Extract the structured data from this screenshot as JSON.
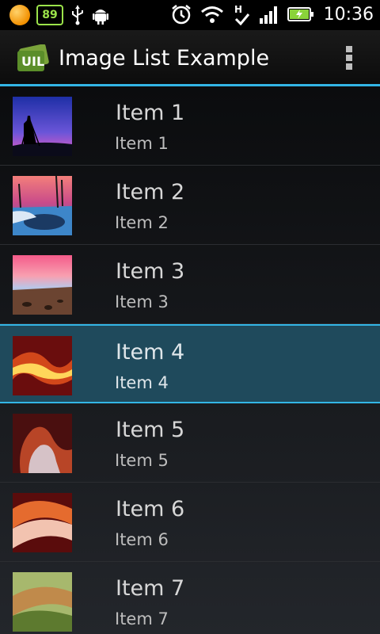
{
  "status_bar": {
    "battery_saver_level": "89",
    "time": "10:36",
    "icons": [
      "notification-dot-icon",
      "battery-level-badge-icon",
      "usb-icon",
      "android-debug-icon",
      "alarm-icon",
      "wifi-icon",
      "hsdpa-icon",
      "signal-bars-icon",
      "battery-charging-icon"
    ]
  },
  "action_bar": {
    "title": "Image List Example",
    "logo_icon": "uil-logo-icon",
    "menu_icon": "overflow-menu-icon"
  },
  "list": {
    "items": [
      {
        "title": "Item 1",
        "subtitle": "Item 1",
        "thumb": "photographer-sunset-icon",
        "selected": false
      },
      {
        "title": "Item 2",
        "subtitle": "Item 2",
        "thumb": "frozen-lake-sunset-icon",
        "selected": false
      },
      {
        "title": "Item 3",
        "subtitle": "Item 3",
        "thumb": "beach-sunset-icon",
        "selected": false
      },
      {
        "title": "Item 4",
        "subtitle": "Item 4",
        "thumb": "canyon-light-icon",
        "selected": true
      },
      {
        "title": "Item 5",
        "subtitle": "Item 5",
        "thumb": "canyon-rock-icon",
        "selected": false
      },
      {
        "title": "Item 6",
        "subtitle": "Item 6",
        "thumb": "sandstone-waves-icon",
        "selected": false
      },
      {
        "title": "Item 7",
        "subtitle": "Item 7",
        "thumb": "blurred-wood-icon",
        "selected": false
      }
    ]
  },
  "colors": {
    "accent": "#33b5e5",
    "selected_row": "#1f4a5c"
  }
}
